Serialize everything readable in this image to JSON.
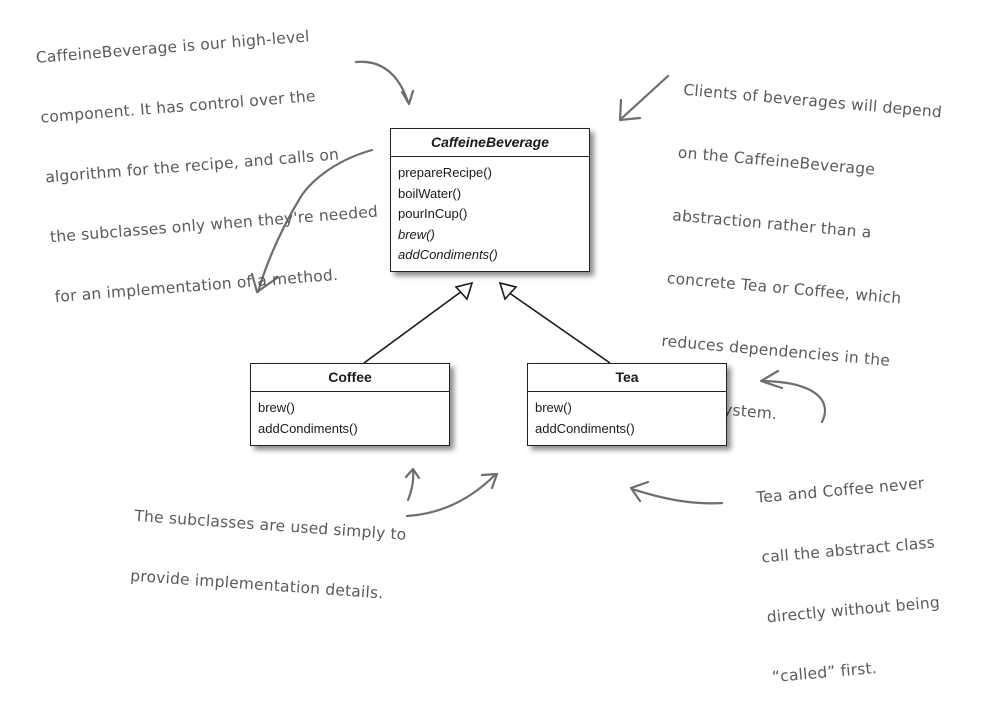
{
  "annotations": {
    "high_level": {
      "lines": [
        "CaffeineBeverage is our high-level",
        "component. It has control over the",
        "algorithm for the recipe, and calls on",
        "the subclasses only when they're needed",
        "for an implementation of a method."
      ]
    },
    "clients": {
      "lines": [
        "Clients of beverages will depend",
        "on the CaffeineBeverage",
        "abstraction rather than a",
        "concrete Tea or Coffee, which",
        "reduces dependencies in the",
        "overall system."
      ]
    },
    "subclasses": {
      "lines": [
        "The subclasses are used simply to",
        "provide implementation details."
      ]
    },
    "never_call": {
      "lines": [
        "Tea and Coffee never",
        "call the abstract class",
        "directly without being",
        "“called” first."
      ]
    }
  },
  "classes": {
    "caffeine_beverage": {
      "name": "CaffeineBeverage",
      "abstract": true,
      "methods": [
        {
          "name": "prepareRecipe()",
          "abstract": false
        },
        {
          "name": "boilWater()",
          "abstract": false
        },
        {
          "name": "pourInCup()",
          "abstract": false
        },
        {
          "name": "brew()",
          "abstract": true
        },
        {
          "name": "addCondiments()",
          "abstract": true
        }
      ]
    },
    "coffee": {
      "name": "Coffee",
      "methods": [
        {
          "name": "brew()"
        },
        {
          "name": "addCondiments()"
        }
      ]
    },
    "tea": {
      "name": "Tea",
      "methods": [
        {
          "name": "brew()"
        },
        {
          "name": "addCondiments()"
        }
      ]
    }
  },
  "relationships": [
    {
      "type": "inheritance",
      "from": "Coffee",
      "to": "CaffeineBeverage"
    },
    {
      "type": "inheritance",
      "from": "Tea",
      "to": "CaffeineBeverage"
    }
  ],
  "colors": {
    "annotation_text": "#5a5a5a",
    "annotation_arrow": "#6e6e6e",
    "uml_border": "#222222"
  }
}
